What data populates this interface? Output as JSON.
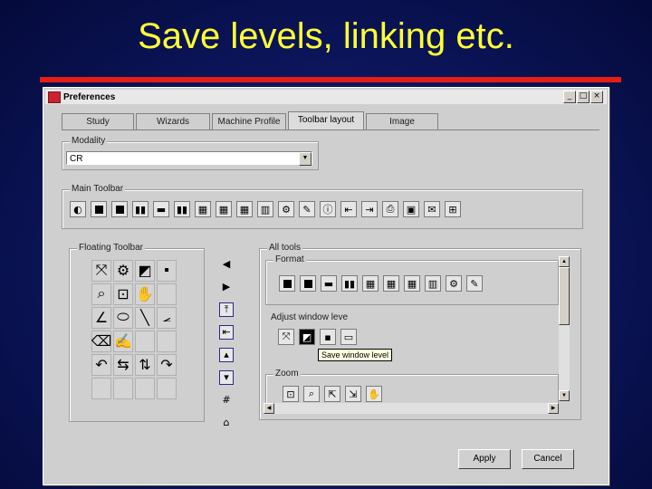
{
  "slide": {
    "title": "Save levels, linking etc."
  },
  "window": {
    "title": "Preferences",
    "min_glyph": "_",
    "max_glyph": "□",
    "close_glyph": "×"
  },
  "tabs": [
    {
      "label": "Study"
    },
    {
      "label": "Wizards"
    },
    {
      "label": "Machine Profile"
    },
    {
      "label": "Toolbar layout",
      "active": true
    },
    {
      "label": "Image"
    }
  ],
  "modality": {
    "label": "Modality",
    "value": "CR"
  },
  "main_toolbar": {
    "label": "Main Toolbar"
  },
  "floating_toolbar": {
    "label": "Floating Toolbar"
  },
  "all_tools": {
    "label": "All tools",
    "sections": [
      {
        "label": "Format"
      },
      {
        "label": "Adjust window leve"
      },
      {
        "label": "Zoom"
      }
    ],
    "tooltip": "Save window level"
  },
  "buttons": {
    "apply": "Apply",
    "cancel": "Cancel"
  },
  "accent_colors": {
    "title": "#ffff33",
    "rule": "#e41e16",
    "background": "#0d1760"
  }
}
